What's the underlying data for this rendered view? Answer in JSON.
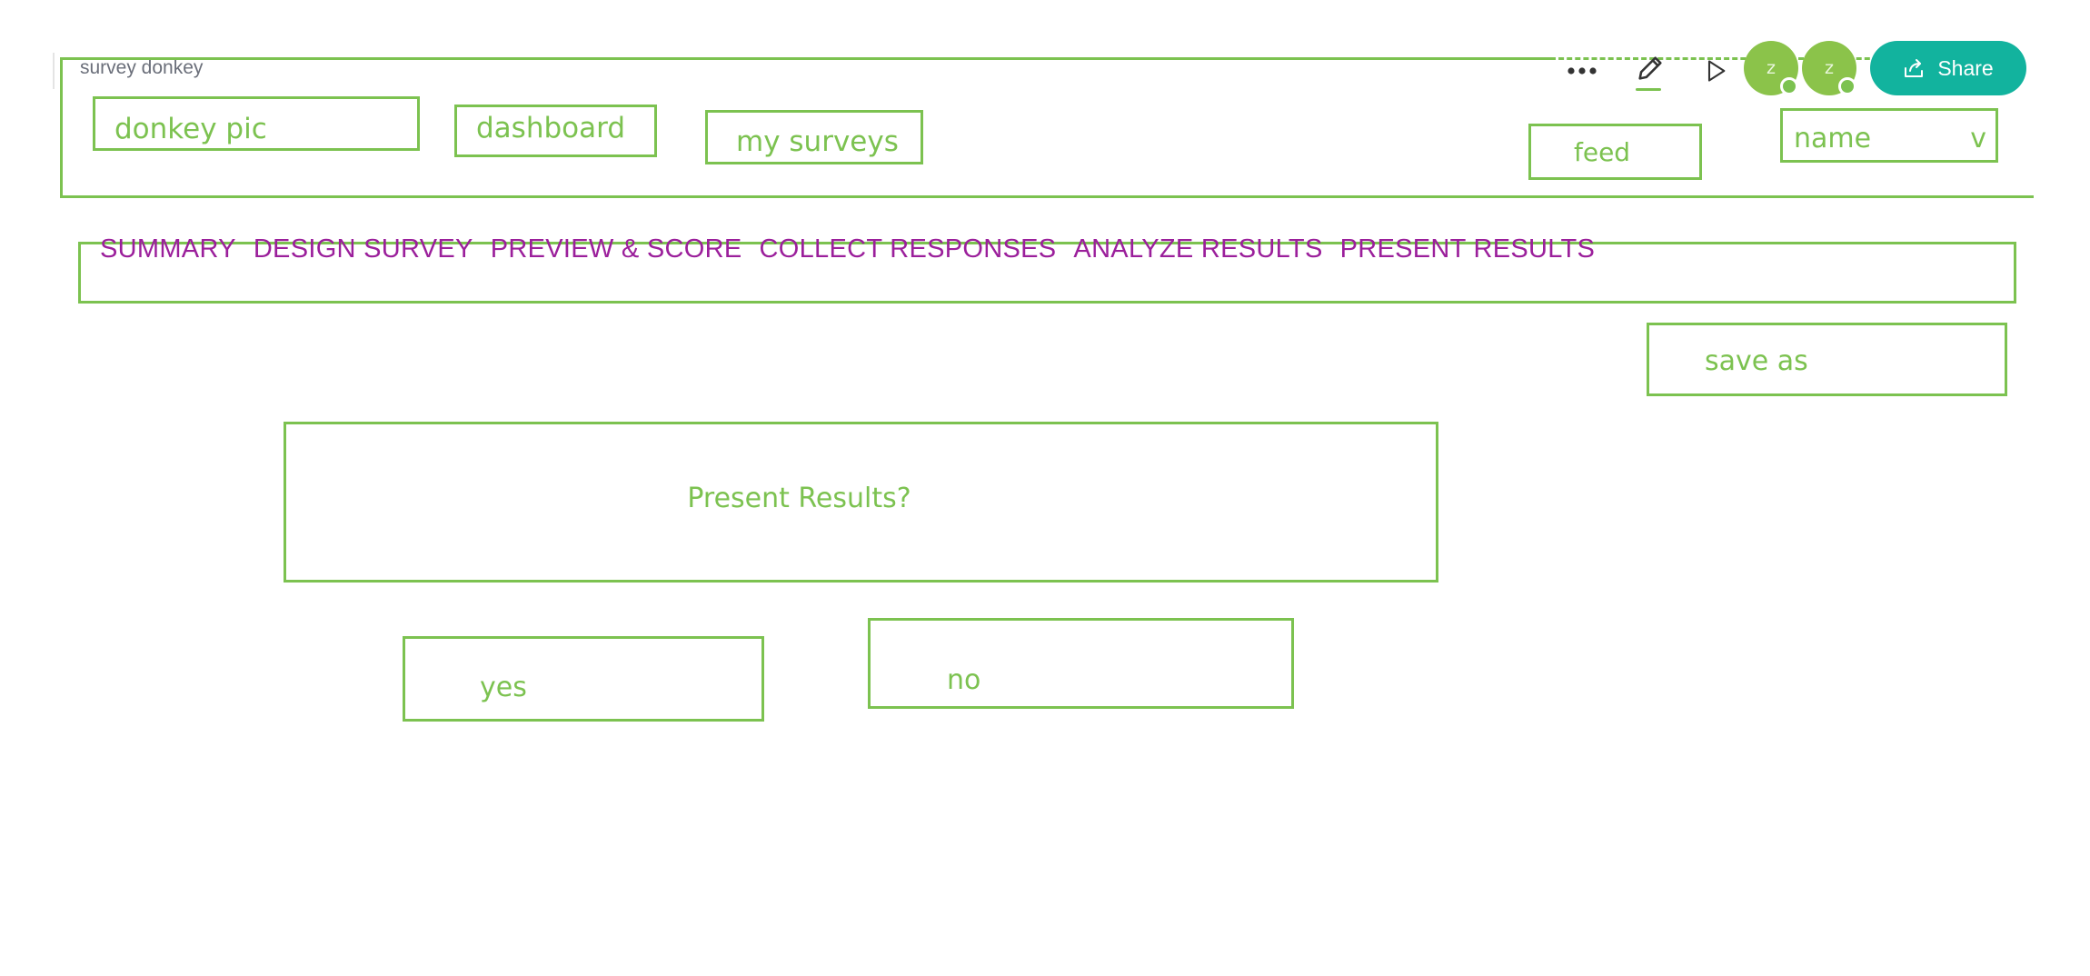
{
  "app": {
    "document_title": "survey donkey"
  },
  "toolbar": {
    "share_label": "Share",
    "avatars": [
      "z",
      "z"
    ],
    "icons": [
      "more-icon",
      "pencil-icon",
      "play-icon",
      "share-arrow-icon"
    ]
  },
  "wireframe": {
    "header": {
      "logo_label": "donkey pic",
      "dashboard_label": "dashboard",
      "my_surveys_label": "my surveys",
      "feed_label": "feed",
      "name_label": "name",
      "name_caret": "v"
    },
    "tabs": [
      "SUMMARY",
      "DESIGN SURVEY",
      "PREVIEW & SCORE",
      "COLLECT RESPONSES",
      "ANALYZE RESULTS",
      "PRESENT RESULTS"
    ],
    "save_as_label": "save as",
    "dialog": {
      "question": "Present Results?",
      "yes_label": "yes",
      "no_label": "no"
    }
  },
  "colors": {
    "sketch": "#7cc250",
    "tabs_text": "#9b1f9b",
    "share_button": "#12b39e",
    "avatar": "#8bc34a"
  }
}
